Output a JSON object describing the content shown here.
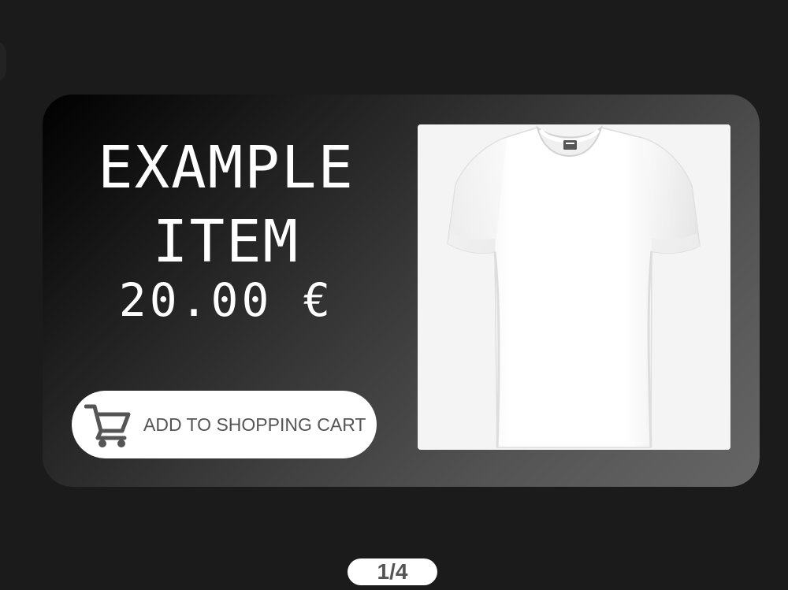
{
  "product": {
    "title_line1": "EXAMPLE",
    "title_line2": "ITEM",
    "price": "20.00 €",
    "image_icon": "white-tshirt-image"
  },
  "cart_button": {
    "label": "ADD TO SHOPPING CART",
    "icon": "shopping-cart-icon"
  },
  "pagination": {
    "label": "1/4"
  },
  "colors": {
    "page_background": "#1b1b1b",
    "card_gradient_start": "#000000",
    "card_gradient_end": "#666666",
    "button_background": "#ffffff",
    "button_text": "#555555",
    "text_primary": "#ffffff"
  }
}
